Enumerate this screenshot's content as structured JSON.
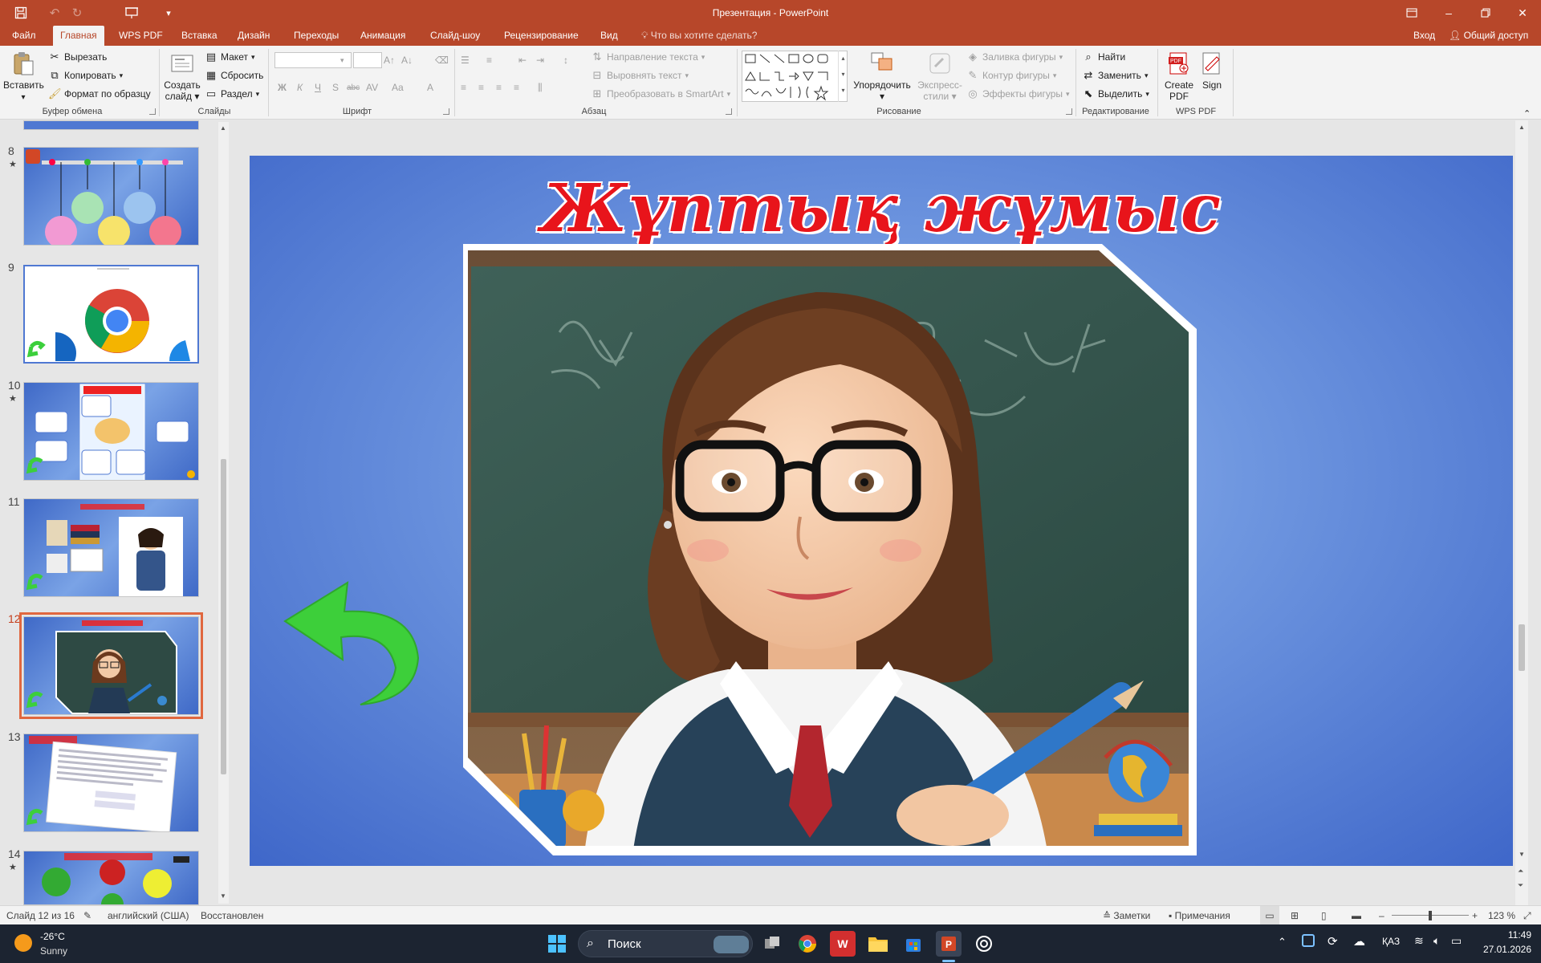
{
  "window": {
    "title": "Презентация - PowerPoint",
    "signin": "Вход",
    "share": "Общий доступ"
  },
  "menu": {
    "tabs": [
      "Файл",
      "Главная",
      "WPS PDF",
      "Вставка",
      "Дизайн",
      "Переходы",
      "Анимация",
      "Слайд-шоу",
      "Рецензирование",
      "Вид"
    ],
    "tell_me": "Что вы хотите сделать?"
  },
  "ribbon": {
    "clipboard": {
      "paste": "Вставить",
      "cut": "Вырезать",
      "copy": "Копировать",
      "format_painter": "Формат по образцу",
      "label": "Буфер обмена"
    },
    "slides": {
      "new_slide_line1": "Создать",
      "new_slide_line2": "слайд",
      "layout": "Макет",
      "reset": "Сбросить",
      "section": "Раздел",
      "label": "Слайды"
    },
    "font": {
      "label": "Шрифт",
      "bold": "Ж",
      "italic": "К",
      "underline": "Ч",
      "shadow": "S",
      "strike": "abc",
      "spacing": "AV",
      "case": "Aa",
      "color": "A"
    },
    "paragraph": {
      "label": "Абзац",
      "text_direction": "Направление текста",
      "align_text": "Выровнять текст",
      "smartart": "Преобразовать в SmartArt"
    },
    "drawing": {
      "label": "Рисование",
      "arrange": "Упорядочить",
      "quick_styles_line1": "Экспресс-",
      "quick_styles_line2": "стили",
      "shape_fill": "Заливка фигуры",
      "shape_outline": "Контур фигуры",
      "shape_effects": "Эффекты фигуры"
    },
    "editing": {
      "label": "Редактирование",
      "find": "Найти",
      "replace": "Заменить",
      "select": "Выделить"
    },
    "wps": {
      "label": "WPS PDF",
      "create_line1": "Create",
      "create_line2": "PDF",
      "sign": "Sign",
      "pdf_badge": "PDF"
    }
  },
  "slides_panel": {
    "items": [
      {
        "num": "8",
        "star": true
      },
      {
        "num": "9",
        "star": false
      },
      {
        "num": "10",
        "star": true
      },
      {
        "num": "11",
        "star": false
      },
      {
        "num": "12",
        "star": false,
        "selected": true
      },
      {
        "num": "13",
        "star": false
      },
      {
        "num": "14",
        "star": true
      }
    ]
  },
  "slide": {
    "title": "Жұптық жұмыс",
    "title_color": "#e8141b"
  },
  "status": {
    "slide_of": "Слайд 12 из 16",
    "language": "английский (США)",
    "restored": "Восстановлен",
    "notes": "Заметки",
    "comments": "Примечания",
    "zoom": "123 %"
  },
  "taskbar": {
    "weather_temp": "-26°C",
    "weather_desc": "Sunny",
    "search": "Поиск",
    "lang": "ҚАЗ",
    "time": "11:49",
    "date": "27.01.2026"
  },
  "colors": {
    "accent": "#b7472a",
    "selection": "#e0673f"
  }
}
